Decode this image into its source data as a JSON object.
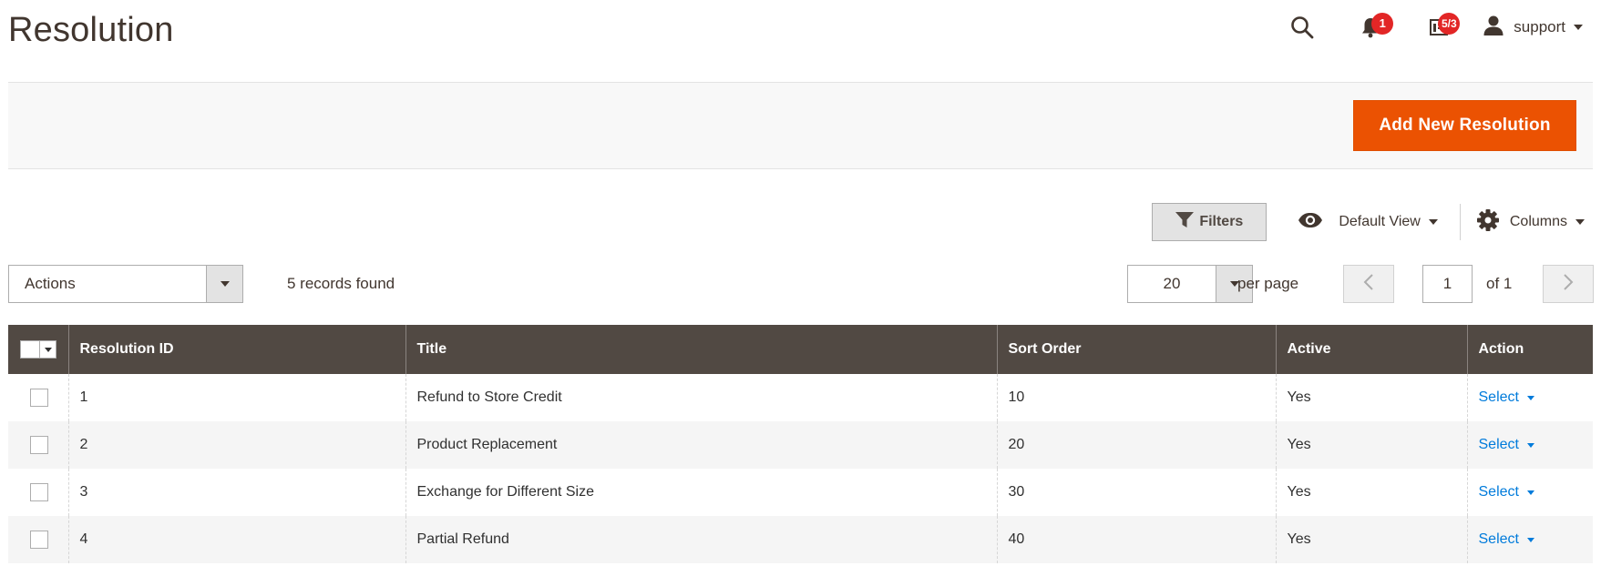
{
  "header": {
    "title": "Resolution",
    "icons": [
      "search-icon",
      "bell-icon",
      "message-icon",
      "user-icon"
    ],
    "notifications_count": "1",
    "messages_count": "5/3",
    "user_name": "support"
  },
  "page_actions": {
    "add_button_label": "Add New Resolution"
  },
  "toolbar": {
    "filters_label": "Filters",
    "view_label": "Default View",
    "columns_label": "Columns",
    "actions_label": "Actions",
    "records_text": "5 records found",
    "per_page_value": "20",
    "per_page_label": "per page",
    "current_page": "1",
    "total_pages_text": "of 1"
  },
  "grid": {
    "columns": [
      "Resolution ID",
      "Title",
      "Sort Order",
      "Active",
      "Action"
    ],
    "rows": [
      {
        "id": "1",
        "title": "Refund to Store Credit",
        "sort_order": "10",
        "active": "Yes",
        "action": "Select"
      },
      {
        "id": "2",
        "title": "Product Replacement",
        "sort_order": "20",
        "active": "Yes",
        "action": "Select"
      },
      {
        "id": "3",
        "title": "Exchange for Different Size",
        "sort_order": "30",
        "active": "Yes",
        "action": "Select"
      },
      {
        "id": "4",
        "title": "Partial Refund",
        "sort_order": "40",
        "active": "Yes",
        "action": "Select"
      }
    ]
  },
  "colors": {
    "accent": "#eb5202",
    "header_bg": "#514943",
    "link": "#007bdb",
    "badge": "#e22626"
  }
}
